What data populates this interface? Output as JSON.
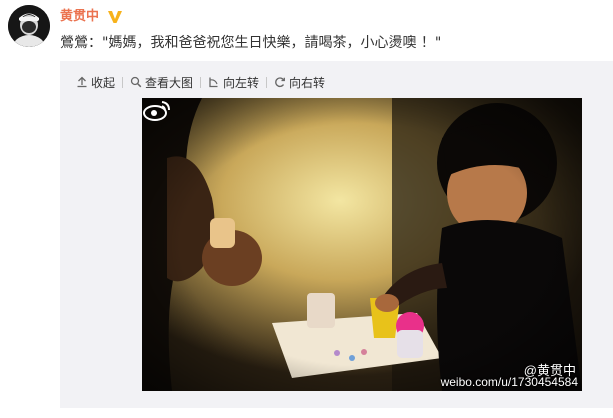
{
  "user": {
    "name": "黄贯中",
    "verified_icon": "verified-v-badge",
    "accent": "#eb7350"
  },
  "post": {
    "text": "鶯鶯：\"媽媽，我和爸爸祝您生日快樂，請喝茶，小心燙噢 ！\""
  },
  "toolbar": {
    "collapse_label": "收起",
    "view_large_label": "查看大图",
    "rotate_left_label": "向左转",
    "rotate_right_label": "向右转"
  },
  "image": {
    "watermark_name": "@黄贯中",
    "watermark_url": "weibo.com/u/1730454584",
    "logo_icon": "weibo-logo"
  }
}
